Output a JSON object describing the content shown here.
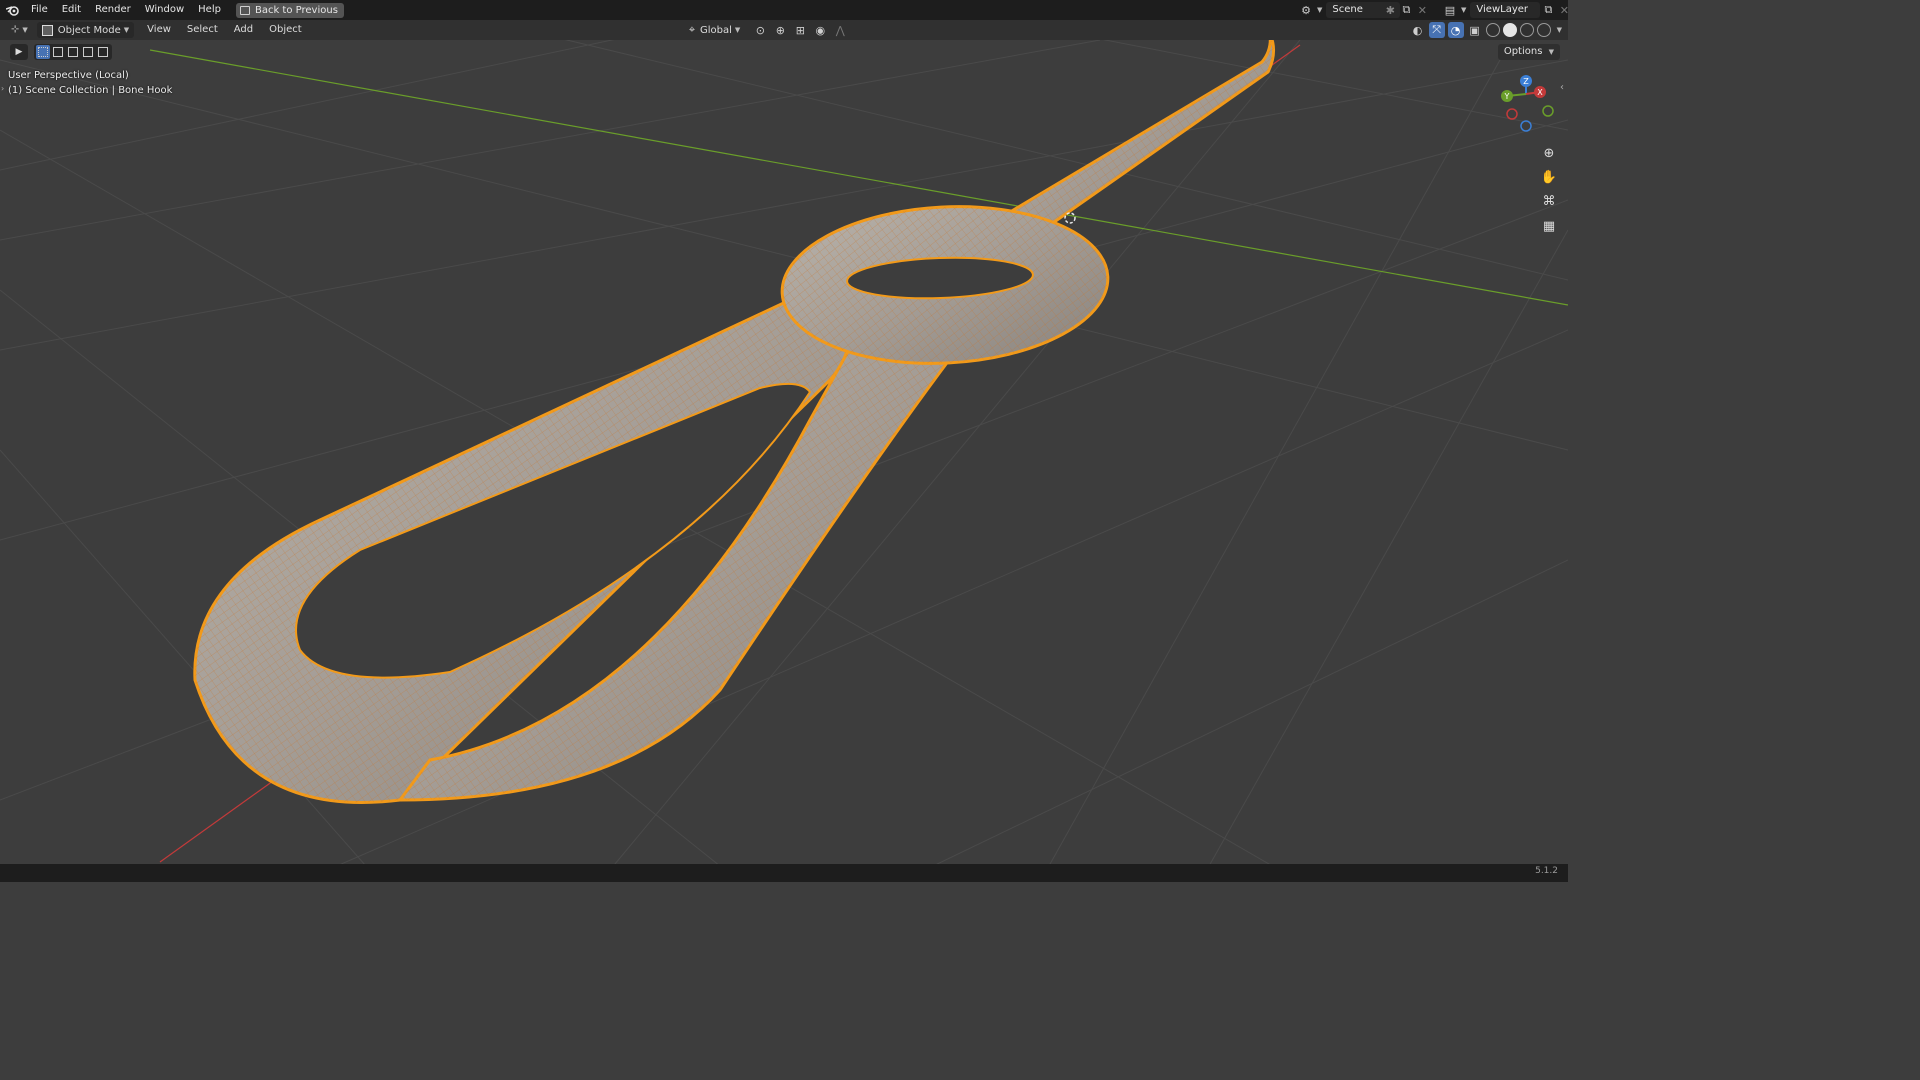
{
  "topbar": {
    "menus": [
      "File",
      "Edit",
      "Render",
      "Window",
      "Help"
    ],
    "back_button": "Back to Previous",
    "scene_name": "Scene",
    "view_layer": "ViewLayer"
  },
  "header": {
    "mode": "Object Mode",
    "menus": [
      "View",
      "Select",
      "Add",
      "Object"
    ],
    "transform_orientation": "Global"
  },
  "viewport": {
    "perspective_label": "User Perspective (Local)",
    "collection_label": "(1) Scene Collection | Bone Hook",
    "options_label": "Options"
  },
  "gizmo": {
    "x": "X",
    "y": "Y",
    "z": "Z"
  },
  "status": {
    "version": "5.1.2"
  },
  "colors": {
    "selection": "#f29a1a",
    "x_axis": "#c33a3a",
    "y_axis": "#6a9e2a",
    "z_axis": "#3b7fd6",
    "viewport_bg": "#3d3d3d"
  }
}
